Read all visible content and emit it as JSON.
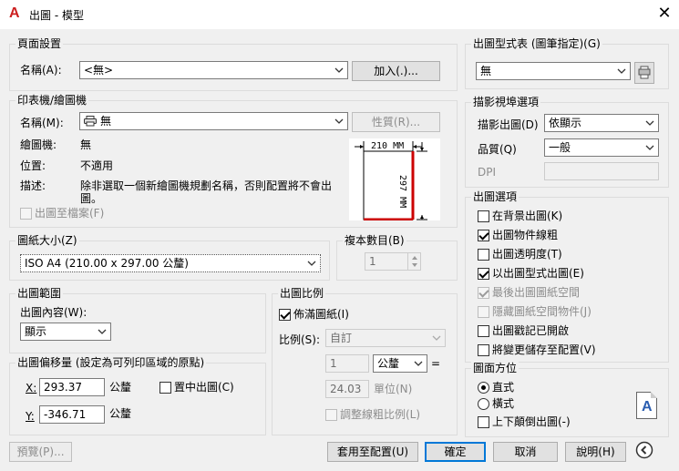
{
  "window": {
    "title": "出圖 - 模型",
    "close": "✕"
  },
  "page_setup": {
    "title": "頁面設置",
    "name_label": "名稱(A):",
    "name_value": "<無>",
    "add_button": "加入(.)..."
  },
  "printer": {
    "title": "印表機/繪圖機",
    "name_label": "名稱(M):",
    "name_value": "無",
    "properties_button": "性質(R)...",
    "plotter_label": "繪圖機:",
    "plotter_value": "無",
    "location_label": "位置:",
    "location_value": "不適用",
    "description_label": "描述:",
    "description_value": "除非選取一個新繪圖機規劃名稱，否則配置將不會出圖。",
    "plot_to_file": "出圖至檔案(F)",
    "paper_width": "210 MM",
    "paper_height": "297 MM"
  },
  "paper_size": {
    "title": "圖紙大小(Z)",
    "value": "ISO A4 (210.00 x 297.00 公釐)"
  },
  "copies": {
    "title": "複本數目(B)",
    "value": "1"
  },
  "plot_area": {
    "title": "出圖範圍",
    "what_label": "出圖內容(W):",
    "what_value": "顯示"
  },
  "plot_offset": {
    "title": "出圖偏移量 (設定為可列印區域的原點)",
    "x_label": "X:",
    "x_value": "293.37",
    "x_unit": "公釐",
    "y_label": "Y:",
    "y_value": "-346.71",
    "y_unit": "公釐",
    "center": "置中出圖(C)"
  },
  "plot_scale": {
    "title": "出圖比例",
    "fit_paper": "佈滿圖紙(I)",
    "scale_label": "比例(S):",
    "scale_value": "自訂",
    "value1": "1",
    "unit": "公釐",
    "equals": "=",
    "value2": "24.03",
    "unit2": "單位(N)",
    "scale_lineweights": "調整線粗比例(L)"
  },
  "plot_style": {
    "title": "出圖型式表 (圖筆指定)(G)",
    "value": "無"
  },
  "shaded_viewport": {
    "title": "描影視埠選項",
    "shade_label": "描影出圖(D)",
    "shade_value": "依顯示",
    "quality_label": "品質(Q)",
    "quality_value": "一般",
    "dpi_label": "DPI"
  },
  "plot_options": {
    "title": "出圖選項",
    "items": [
      {
        "label": "在背景出圖(K)",
        "checked": false,
        "disabled": false
      },
      {
        "label": "出圖物件線粗",
        "checked": true,
        "disabled": false
      },
      {
        "label": "出圖透明度(T)",
        "checked": false,
        "disabled": false
      },
      {
        "label": "以出圖型式出圖(E)",
        "checked": true,
        "disabled": false
      },
      {
        "label": "最後出圖圖紙空間",
        "checked": true,
        "disabled": true
      },
      {
        "label": "隱藏圖紙空間物件(J)",
        "checked": false,
        "disabled": true
      },
      {
        "label": "出圖戳記已開啟",
        "checked": false,
        "disabled": false
      },
      {
        "label": "將變更儲存至配置(V)",
        "checked": false,
        "disabled": false
      }
    ]
  },
  "orientation": {
    "title": "圖面方位",
    "portrait": "直式",
    "landscape": "橫式",
    "upside_down": "上下顛倒出圖(-)",
    "icon_letter": "A"
  },
  "buttons": {
    "preview": "預覽(P)...",
    "apply": "套用至配置(U)",
    "ok": "確定",
    "cancel": "取消",
    "help": "說明(H)"
  },
  "colors": {
    "accent": "#0078d7",
    "paper_red": "#cc0000"
  }
}
